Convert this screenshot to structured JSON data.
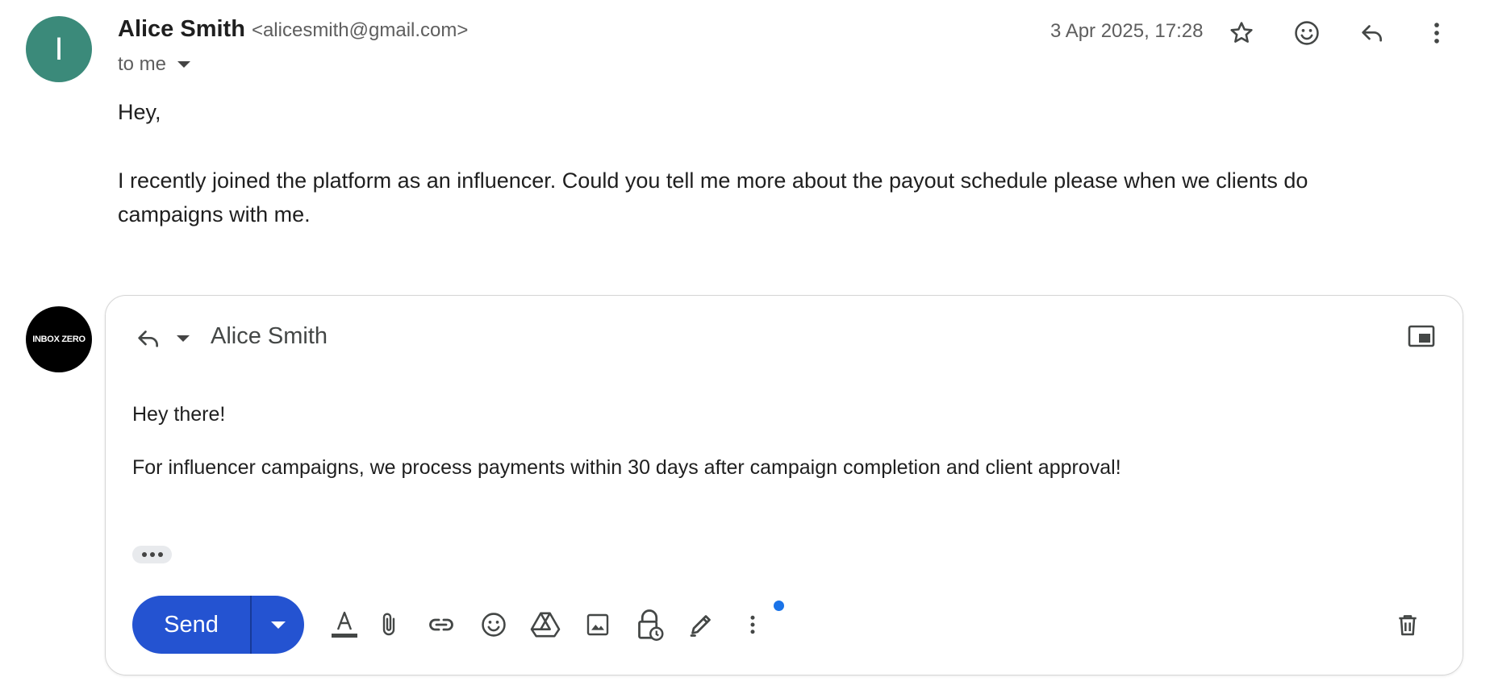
{
  "message": {
    "avatar_letter": "I",
    "sender_name": "Alice Smith",
    "sender_email": "<alicesmith@gmail.com>",
    "to_label": "to me",
    "timestamp": "3 Apr 2025, 17:28",
    "body": [
      "Hey,",
      "I recently joined the platform as an influencer. Could you tell me more about the payout schedule please when we clients do campaigns with me."
    ],
    "icons": [
      "star-icon",
      "emoji-icon",
      "reply-icon",
      "more-vert-icon"
    ]
  },
  "composer": {
    "avatar_text": "INBOX ZERO",
    "recipient": "Alice Smith",
    "body": [
      "Hey there!",
      "For influencer campaigns, we process payments within 30 days after campaign completion and client approval!"
    ],
    "send_label": "Send",
    "toolbar_icons": [
      "format-text-icon",
      "attach-icon",
      "link-icon",
      "emoji-icon",
      "drive-icon",
      "image-icon",
      "confidential-lock-icon",
      "signature-pen-icon",
      "more-vert-icon",
      "trash-icon"
    ],
    "accent_color": "#2453d1",
    "notification_dot_color": "#1a73e8"
  }
}
